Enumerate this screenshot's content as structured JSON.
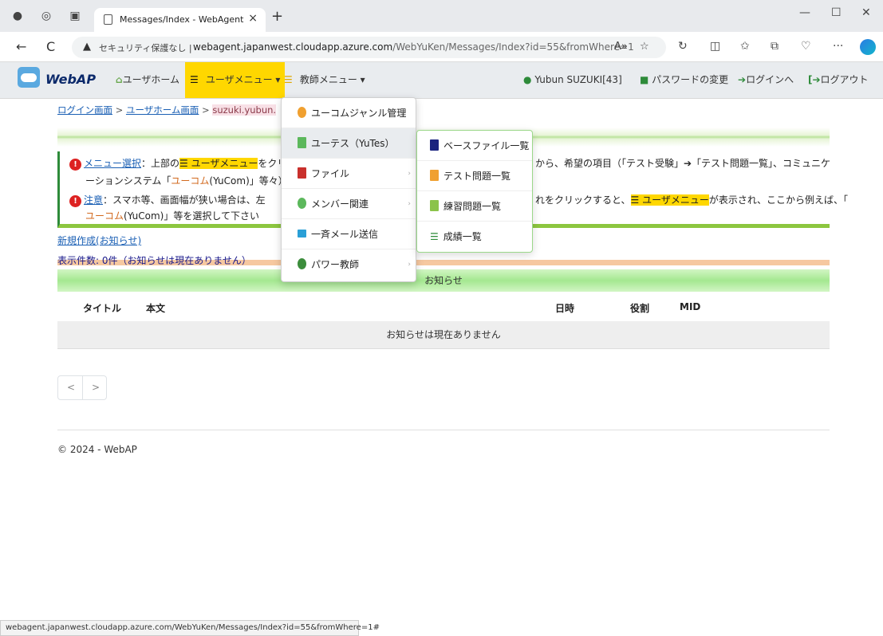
{
  "browser": {
    "tab_title": "Messages/Index - WebAgent",
    "tab_close": "×",
    "new_tab": "+",
    "security_text": "セキュリティ保護なし",
    "separator": "|",
    "url_host": "webagent.japanwest.cloudapp.azure.com",
    "url_path": "/WebYuKen/Messages/Index?id=55&fromWhere=1",
    "reader_label": "A»",
    "status_url": "webagent.japanwest.cloudapp.azure.com/WebYuKen/Messages/Index?id=55&fromWhere=1#"
  },
  "navbar": {
    "brand": "WebAP",
    "user_home": "ユーザホーム",
    "user_menu": "ユーザメニュー",
    "teacher_menu": "教師メニュー",
    "user_name": "Yubun SUZUKI[43]",
    "change_password": "パスワードの変更",
    "login": "ログインへ",
    "logout": "ログアウト"
  },
  "breadcrumb": {
    "login": "ログイン画面",
    "sep": ">",
    "user_home": "ユーザホーム画面",
    "current": "suzuki.yubun."
  },
  "info": {
    "menu_select_label": "メニュー選択",
    "line1a": "：上部の",
    "user_menu": "ユーザメニュー",
    "line1b": "をクリ",
    "line1c": "から、希望の項目（「テスト受験」➔「テスト問題一覧」、コミュニケ",
    "line2a": "ーションシステム「",
    "yucom_word": "ユーコム",
    "line2b": "(YuCom)」等々）",
    "note_label": "注意",
    "line3a": "：スマホ等、画面幅が狭い場合は、左",
    "line3b": "れをクリックすると、",
    "line3c": "が表示され、ここから例えば、「",
    "line4a": "(YuCom)」等を選択して下さい"
  },
  "new_link": "新規作成(お知らせ)",
  "count_text": "表示件数: 0件（お知らせは現在ありません）",
  "notice_title": "お知らせ",
  "table": {
    "headers": [
      "タイトル",
      "本文",
      "日時",
      "役割",
      "MID"
    ],
    "empty_message": "お知らせは現在ありません"
  },
  "pager": {
    "prev": "<",
    "next": ">"
  },
  "footer": "© 2024 - WebAP",
  "dropdown": {
    "items": [
      "ユーコムジャンル管理",
      "ユーテス（YuTes）",
      "ファイル",
      "メンバー関連",
      "一斉メール送信",
      "パワー教師"
    ],
    "caret": "›"
  },
  "submenu": {
    "items": [
      "ベースファイル一覧",
      "テスト問題一覧",
      "練習問題一覧",
      "成績一覧"
    ]
  },
  "colors": {
    "highlight": "#ffd700",
    "link": "#1a5fb4",
    "green_border": "#2e8b3a",
    "brand_text": "#0c2a6b"
  },
  "icons": {
    "back": "←",
    "reload": "C",
    "warn": "▲",
    "star": "☆",
    "more": "···",
    "minimize": "—",
    "maximize": "☐",
    "close": "✕",
    "list": "☰",
    "down": "▾",
    "bang": "!"
  }
}
